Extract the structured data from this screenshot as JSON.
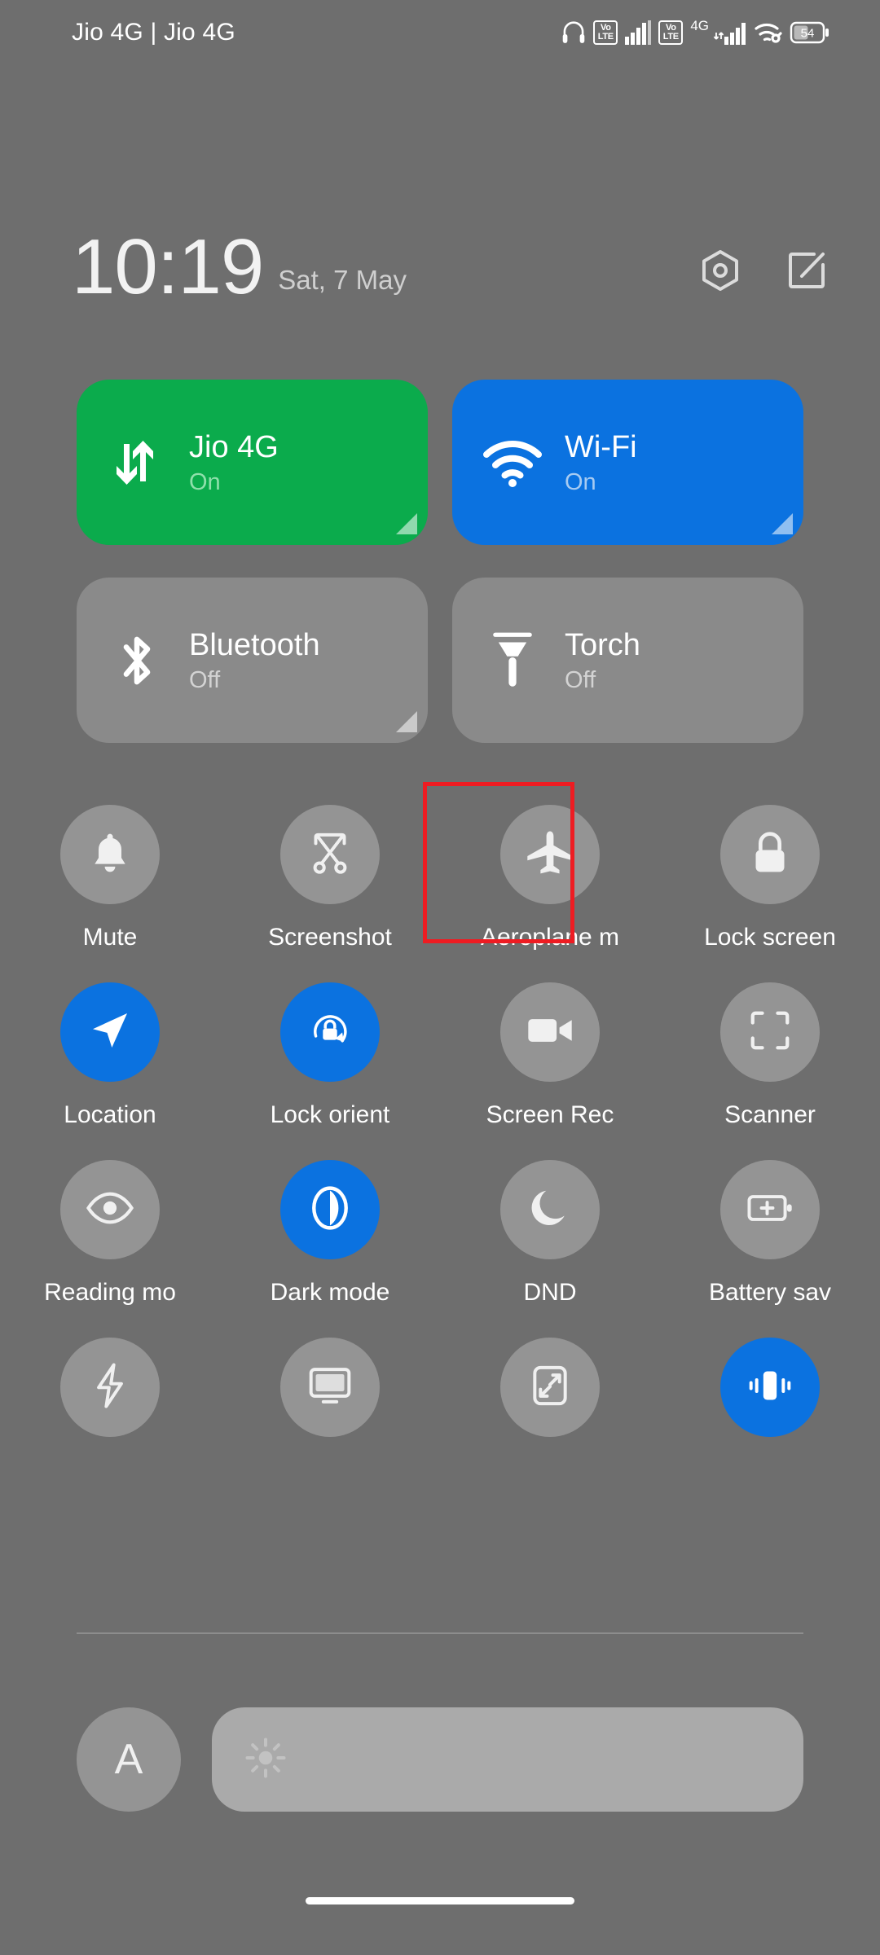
{
  "status_bar": {
    "carrier_text": "Jio 4G | Jio 4G",
    "icons": [
      {
        "name": "headset-icon"
      },
      {
        "name": "volte-sim1-icon",
        "label_top": "Vo",
        "label_bottom": "LTE"
      },
      {
        "name": "signal-sim1-icon"
      },
      {
        "name": "volte-sim2-icon",
        "label_top": "Vo",
        "label_bottom": "LTE"
      },
      {
        "name": "network-4g-icon",
        "label": "4G"
      },
      {
        "name": "signal-sim2-icon"
      },
      {
        "name": "wifi-icon"
      },
      {
        "name": "battery-icon",
        "level_text": "54"
      }
    ],
    "battery_level": "54"
  },
  "header": {
    "time": "10:19",
    "date": "Sat, 7 May",
    "settings_icon": "hexagon-settings-icon",
    "edit_icon": "edit-pencil-icon"
  },
  "big_tiles": [
    {
      "label": "Jio 4G",
      "state": "On",
      "icon": "data-transfer-icon",
      "style": "on-green",
      "expandable": true
    },
    {
      "label": "Wi-Fi",
      "state": "On",
      "icon": "wifi-icon",
      "style": "on-blue",
      "expandable": true
    },
    {
      "label": "Bluetooth",
      "state": "Off",
      "icon": "bluetooth-icon",
      "style": "off",
      "expandable": true
    },
    {
      "label": "Torch",
      "state": "Off",
      "icon": "torch-icon",
      "style": "off",
      "expandable": false
    }
  ],
  "toggles": [
    {
      "label": "Mute",
      "icon": "bell-icon",
      "active": false,
      "highlighted": false
    },
    {
      "label": "Screenshot",
      "icon": "scissors-icon",
      "active": false,
      "highlighted": false
    },
    {
      "label": "Aeroplane m",
      "icon": "aeroplane-icon",
      "active": false,
      "highlighted": true
    },
    {
      "label": "Lock screen",
      "icon": "padlock-icon",
      "active": false,
      "highlighted": false
    },
    {
      "label": "Location",
      "icon": "navigation-arrow-icon",
      "active": true,
      "highlighted": false
    },
    {
      "label": "Lock orient",
      "icon": "rotation-lock-icon",
      "active": true,
      "highlighted": false
    },
    {
      "label": "Screen Rec",
      "icon": "video-camera-icon",
      "active": false,
      "highlighted": false
    },
    {
      "label": "Scanner",
      "icon": "scan-frame-icon",
      "active": false,
      "highlighted": false
    },
    {
      "label": "Reading mo",
      "icon": "eye-icon",
      "active": false,
      "highlighted": false
    },
    {
      "label": "Dark mode",
      "icon": "contrast-icon",
      "active": true,
      "highlighted": false
    },
    {
      "label": "DND",
      "icon": "moon-icon",
      "active": false,
      "highlighted": false
    },
    {
      "label": "Battery sav",
      "icon": "battery-plus-icon",
      "active": false,
      "highlighted": false
    },
    {
      "label": "",
      "icon": "lightning-bolt-icon",
      "active": false,
      "highlighted": false
    },
    {
      "label": "",
      "icon": "cast-monitor-icon",
      "active": false,
      "highlighted": false
    },
    {
      "label": "",
      "icon": "shrink-screen-icon",
      "active": false,
      "highlighted": false
    },
    {
      "label": "",
      "icon": "vibration-icon",
      "active": true,
      "highlighted": false
    }
  ],
  "brightness": {
    "auto_label": "A",
    "auto_icon": "auto-brightness-icon",
    "slider_icon": "sun-icon",
    "slider_value_percent": 0
  },
  "colors": {
    "background": "#6e6e6e",
    "tile_inactive": "#8a8a8a",
    "circle_inactive": "#949494",
    "accent_blue": "#0b72e0",
    "accent_green": "#0bab4c",
    "highlight_red": "#ee1c22",
    "slider_track": "#aaaaaa"
  }
}
